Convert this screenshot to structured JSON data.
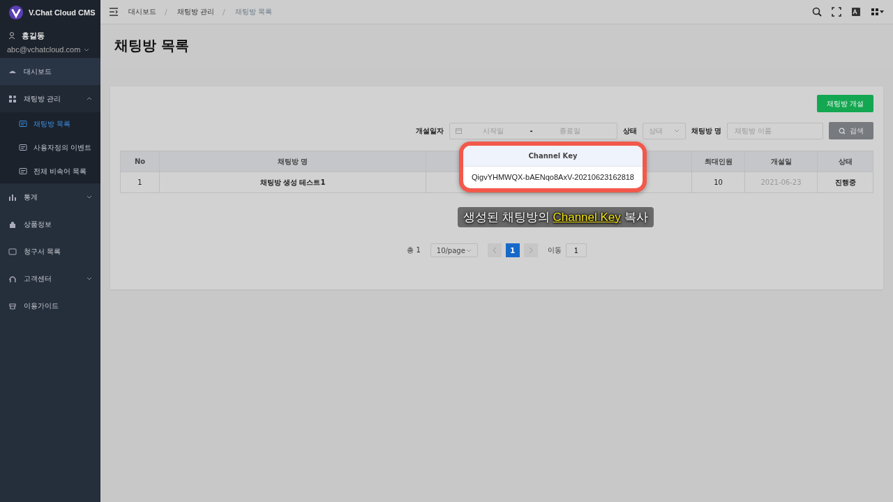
{
  "brand": {
    "name": "V.Chat Cloud CMS"
  },
  "user": {
    "name": "홍길동",
    "email": "abc@vchatcloud.com"
  },
  "sidebar": {
    "items": [
      {
        "label": "대시보드",
        "has_caret": false
      },
      {
        "label": "채팅방 관리",
        "expanded": true,
        "has_caret": true,
        "children": [
          {
            "label": "채팅방 목록",
            "selected": true
          },
          {
            "label": "사용자정의 이벤트",
            "selected": false
          },
          {
            "label": "전체 비속어 목록",
            "selected": false
          }
        ]
      },
      {
        "label": "통계",
        "expanded": false,
        "has_caret": true
      },
      {
        "label": "상품정보",
        "has_caret": false
      },
      {
        "label": "청구서 목록",
        "has_caret": false
      },
      {
        "label": "고객센터",
        "expanded": false,
        "has_caret": true
      },
      {
        "label": "이용가이드",
        "has_caret": false
      }
    ]
  },
  "breadcrumb": {
    "separator": "/",
    "items": [
      "대시보드",
      "채팅방 관리",
      "채팅방 목록"
    ]
  },
  "page_title": "채팅방 목록",
  "create_button": "채팅방 개설",
  "filters": {
    "date_label": "개설일자",
    "start_placeholder": "시작일",
    "separator": "-",
    "end_placeholder": "종료일",
    "status_label": "상태",
    "status_placeholder": "상태",
    "name_label": "채팅방 명",
    "name_placeholder": "채팅방 이름",
    "search_button": "검색"
  },
  "table": {
    "columns": [
      "No",
      "채팅방 명",
      "Channel Key",
      "최대인원",
      "개설일",
      "상태"
    ],
    "rows": [
      [
        "1",
        "채팅방 생성 테스트1",
        "QigvYHMWQX-bAENqo8AxV-20210623162818",
        "10",
        "2021-06-23",
        "진행중"
      ]
    ]
  },
  "caption": {
    "before": "생성된 채팅방의",
    "highlight": "Channel Key",
    "after": "복사"
  },
  "pagination": {
    "total": "총 1",
    "page_size": "10/page",
    "pages": [
      {
        "label": "1",
        "selected": true
      }
    ],
    "goto_label": "이동",
    "goto_value": "1"
  }
}
